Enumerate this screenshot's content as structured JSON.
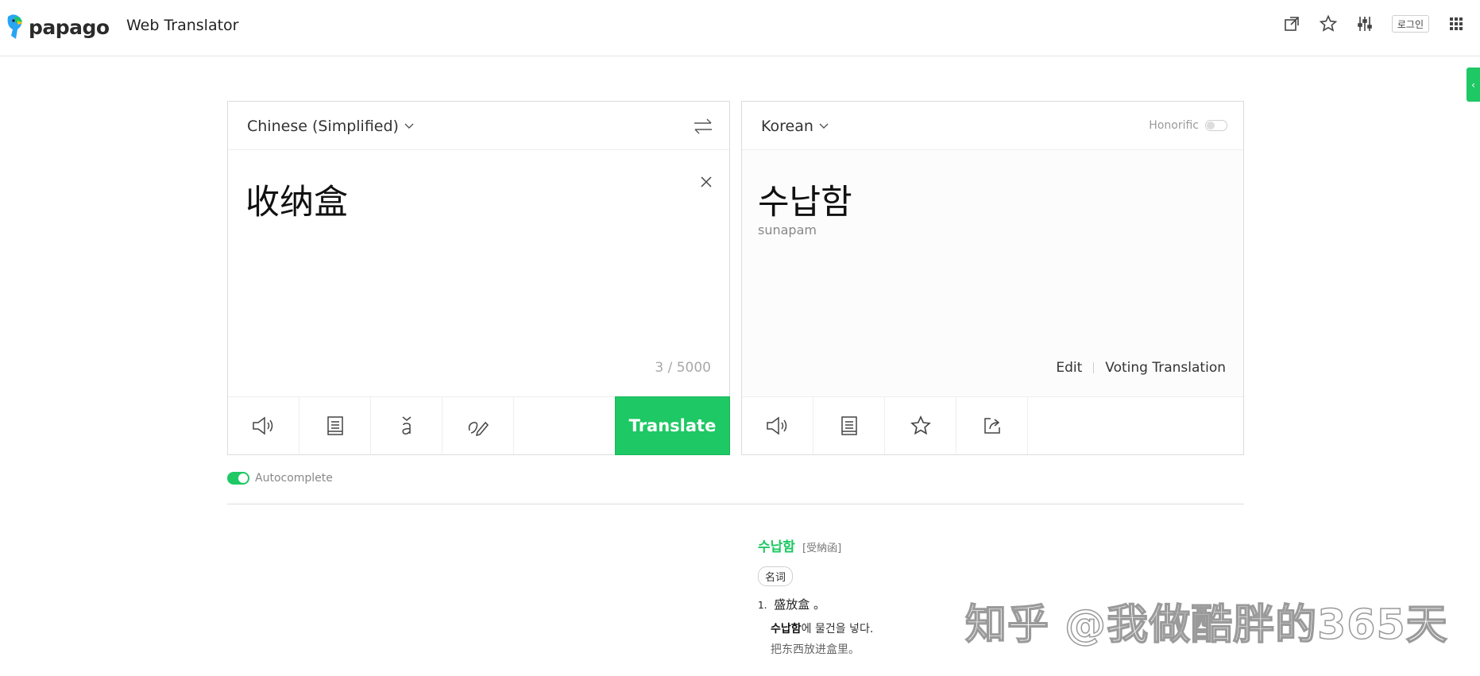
{
  "header": {
    "logo_text": "papago",
    "service_title": "Web Translator",
    "login_label": "로그인",
    "icons": [
      "external-window-icon",
      "star-icon",
      "settings-sliders-icon",
      "apps-grid-icon"
    ]
  },
  "source": {
    "language": "Chinese (Simplified)",
    "text": "收纳盒",
    "char_count": "3 / 5000",
    "translate_label": "Translate",
    "tools": [
      "speaker-icon",
      "document-icon",
      "pinyin-icon",
      "handwriting-icon"
    ]
  },
  "target": {
    "language": "Korean",
    "honorific_label": "Honorific",
    "text": "수납함",
    "pronunciation": "sunapam",
    "edit_label": "Edit",
    "voting_label": "Voting Translation",
    "tools": [
      "speaker-icon",
      "document-icon",
      "star-icon",
      "share-icon"
    ]
  },
  "autocomplete_label": "Autocomplete",
  "dictionary": {
    "word": "수납함",
    "hanja": "[受納函]",
    "pos": "名词",
    "meaning_number": "1.",
    "meaning": "盛放盒 。",
    "example_ko_bold": "수납함",
    "example_ko_rest": "에 물건을 넣다.",
    "example_zh": "把东西放进盒里。"
  },
  "watermark": "知乎 @我做酷胖的365天",
  "colors": {
    "accent": "#1ec864"
  }
}
